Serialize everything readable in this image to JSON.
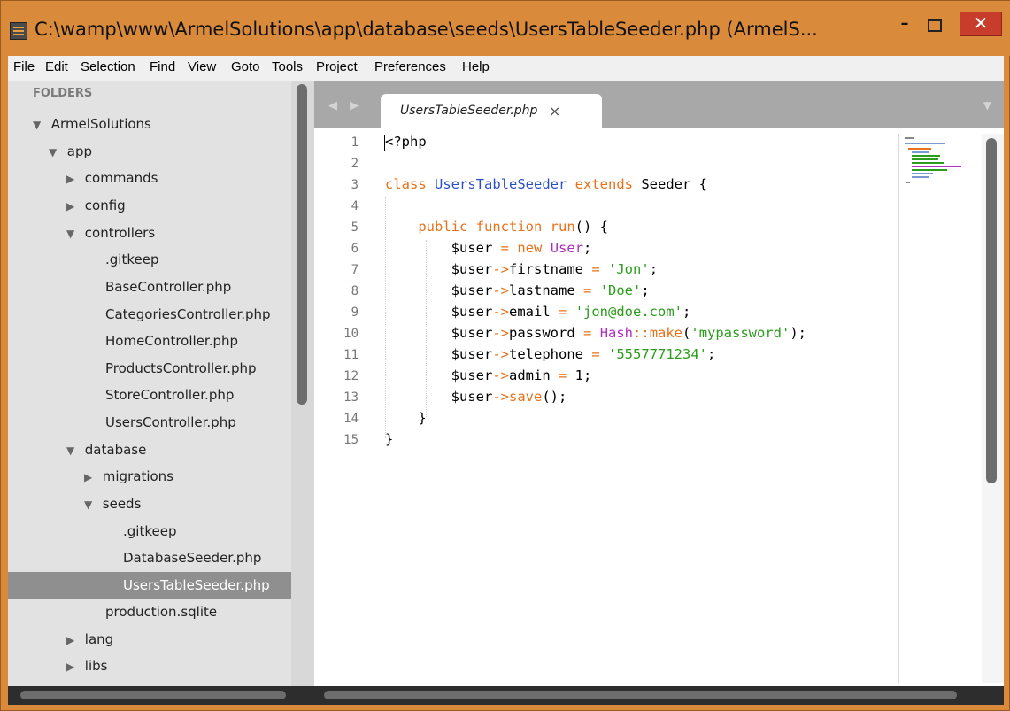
{
  "window": {
    "title": "C:\\wamp\\www\\ArmelSolutions\\app\\database\\seeds\\UsersTableSeeder.php (ArmelS...",
    "minimize_label": "–",
    "close_label": "✕"
  },
  "menu": {
    "file": "File",
    "edit": "Edit",
    "selection": "Selection",
    "find": "Find",
    "view": "View",
    "goto": "Goto",
    "tools": "Tools",
    "project": "Project",
    "preferences": "Preferences",
    "help": "Help"
  },
  "sidebar": {
    "heading": "FOLDERS",
    "items": [
      {
        "label": "ArmelSolutions",
        "arrow": "▼"
      },
      {
        "label": "app",
        "arrow": "▼"
      },
      {
        "label": "commands",
        "arrow": "▶"
      },
      {
        "label": "config",
        "arrow": "▶"
      },
      {
        "label": "controllers",
        "arrow": "▼"
      },
      {
        "label": ".gitkeep",
        "arrow": ""
      },
      {
        "label": "BaseController.php",
        "arrow": ""
      },
      {
        "label": "CategoriesController.php",
        "arrow": ""
      },
      {
        "label": "HomeController.php",
        "arrow": ""
      },
      {
        "label": "ProductsController.php",
        "arrow": ""
      },
      {
        "label": "StoreController.php",
        "arrow": ""
      },
      {
        "label": "UsersController.php",
        "arrow": ""
      },
      {
        "label": "database",
        "arrow": "▼"
      },
      {
        "label": "migrations",
        "arrow": "▶"
      },
      {
        "label": "seeds",
        "arrow": "▼"
      },
      {
        "label": ".gitkeep",
        "arrow": ""
      },
      {
        "label": "DatabaseSeeder.php",
        "arrow": ""
      },
      {
        "label": "UsersTableSeeder.php",
        "arrow": ""
      },
      {
        "label": "production.sqlite",
        "arrow": ""
      },
      {
        "label": "lang",
        "arrow": "▶"
      },
      {
        "label": "libs",
        "arrow": "▶"
      }
    ],
    "selected_item": "UsersTableSeeder.php"
  },
  "tabs": {
    "nav_arrows": "◀ ▶",
    "active_tab": "UsersTableSeeder.php",
    "close": "×",
    "dropdown": "▼"
  },
  "editor": {
    "line_numbers": [
      "1",
      "2",
      "3",
      "4",
      "5",
      "6",
      "7",
      "8",
      "9",
      "10",
      "11",
      "12",
      "13",
      "14",
      "15"
    ],
    "lines": [
      "<?php",
      "",
      "class UsersTableSeeder extends Seeder {",
      "",
      "    public function run() {",
      "        $user = new User;",
      "        $user->firstname = 'Jon';",
      "        $user->lastname = 'Doe';",
      "        $user->email = 'jon@doe.com';",
      "        $user->password = Hash::make('mypassword');",
      "        $user->telephone = '5557771234';",
      "        $user->admin = 1;",
      "        $user->save();",
      "    }",
      "}"
    ]
  },
  "colors": {
    "keyword": "#e8711a",
    "class_name": "#2b4fc7",
    "string": "#2a9d1a",
    "type": "#b02ec0",
    "selected_row": "#8f8f8f",
    "titlebar": "#d98a3a",
    "close_button": "#c73c2a"
  }
}
